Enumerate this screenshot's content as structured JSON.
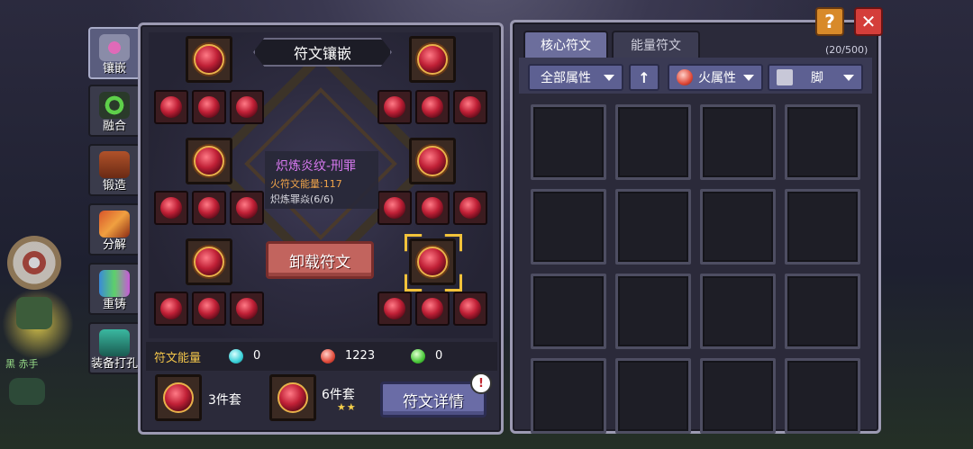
{
  "sidebar": {
    "tabs": [
      {
        "label": "镶嵌",
        "icon": "inlay-icon"
      },
      {
        "label": "融合",
        "icon": "fusion-icon"
      },
      {
        "label": "锻造",
        "icon": "forge-icon"
      },
      {
        "label": "分解",
        "icon": "decompose-icon"
      },
      {
        "label": "重铸",
        "icon": "recast-icon"
      },
      {
        "label": "装备打孔",
        "icon": "punch-icon"
      }
    ]
  },
  "background": {
    "name_tag": "黑 赤手"
  },
  "rune_inlay": {
    "title": "符文镶嵌",
    "tooltip": {
      "name": "炽炼炎纹-刑罪",
      "energy": "火符文能量:117",
      "set": "炽炼罪焱(6/6)"
    },
    "unload_button": "卸载符文"
  },
  "energy": {
    "label": "符文能量",
    "items": [
      {
        "icon": "water-gem-icon",
        "value": "0"
      },
      {
        "icon": "fire-gem-icon",
        "value": "1223"
      },
      {
        "icon": "nature-gem-icon",
        "value": "0"
      }
    ]
  },
  "sets": [
    {
      "label": "3件套"
    },
    {
      "label": "6件套",
      "stars": "★★"
    }
  ],
  "detail_button": "符文详情",
  "detail_badge": "!",
  "inventory": {
    "tabs": [
      "核心符文",
      "能量符文"
    ],
    "count": "(20/500)",
    "filters": {
      "attribute": "全部属性",
      "sort": "↑",
      "element": "火属性",
      "slot": "脚"
    }
  },
  "top_buttons": {
    "help": "?",
    "close": "✕"
  },
  "colors": {
    "accent_purple": "#d879f0",
    "energy_orange": "#f0a44a",
    "selection_gold": "#f2c23a"
  }
}
